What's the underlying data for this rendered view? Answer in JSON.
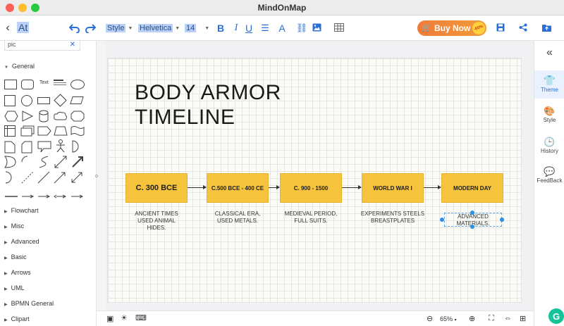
{
  "window": {
    "title": "MindOnMap"
  },
  "toolbar": {
    "back_text": "At",
    "style_select": "Style",
    "font_select": "Helvetica",
    "size_select": "14",
    "buy_now": "Buy Now",
    "buy_badge": "-60%"
  },
  "left_panel": {
    "search_value": "pic",
    "general_label": "General",
    "text_shape_label": "Text",
    "categories": [
      "Flowchart",
      "Misc",
      "Advanced",
      "Basic",
      "Arrows",
      "UML",
      "BPMN General",
      "Clipart"
    ]
  },
  "canvas": {
    "title_line1": "BODY ARMOR",
    "title_line2": "TIMELINE",
    "boxes": [
      "C. 300 BCE",
      "C.500 BCE - 400 CE",
      "C. 900 - 1500",
      "WORLD WAR I",
      "MODERN DAY"
    ],
    "captions": [
      [
        "ANCIENT TIMES",
        "USED ANIMAL",
        "HIDES."
      ],
      [
        "CLASSICAL ERA,",
        "USED METALS."
      ],
      [
        "MEDIEVAL PERIOD,",
        "FULL SUITS."
      ],
      [
        "EXPERIMENTS STEELS",
        "BREASTPLATES"
      ],
      [
        "ADVANCED",
        "MATERIALS."
      ]
    ]
  },
  "right_panel": {
    "items": [
      "Theme",
      "Style",
      "History",
      "FeedBack"
    ]
  },
  "bottom_bar": {
    "zoom": "65%"
  },
  "colors": {
    "accent": "#2b6fd6",
    "box_fill": "#f5c43c",
    "buy_now": "#ef7c3a"
  }
}
